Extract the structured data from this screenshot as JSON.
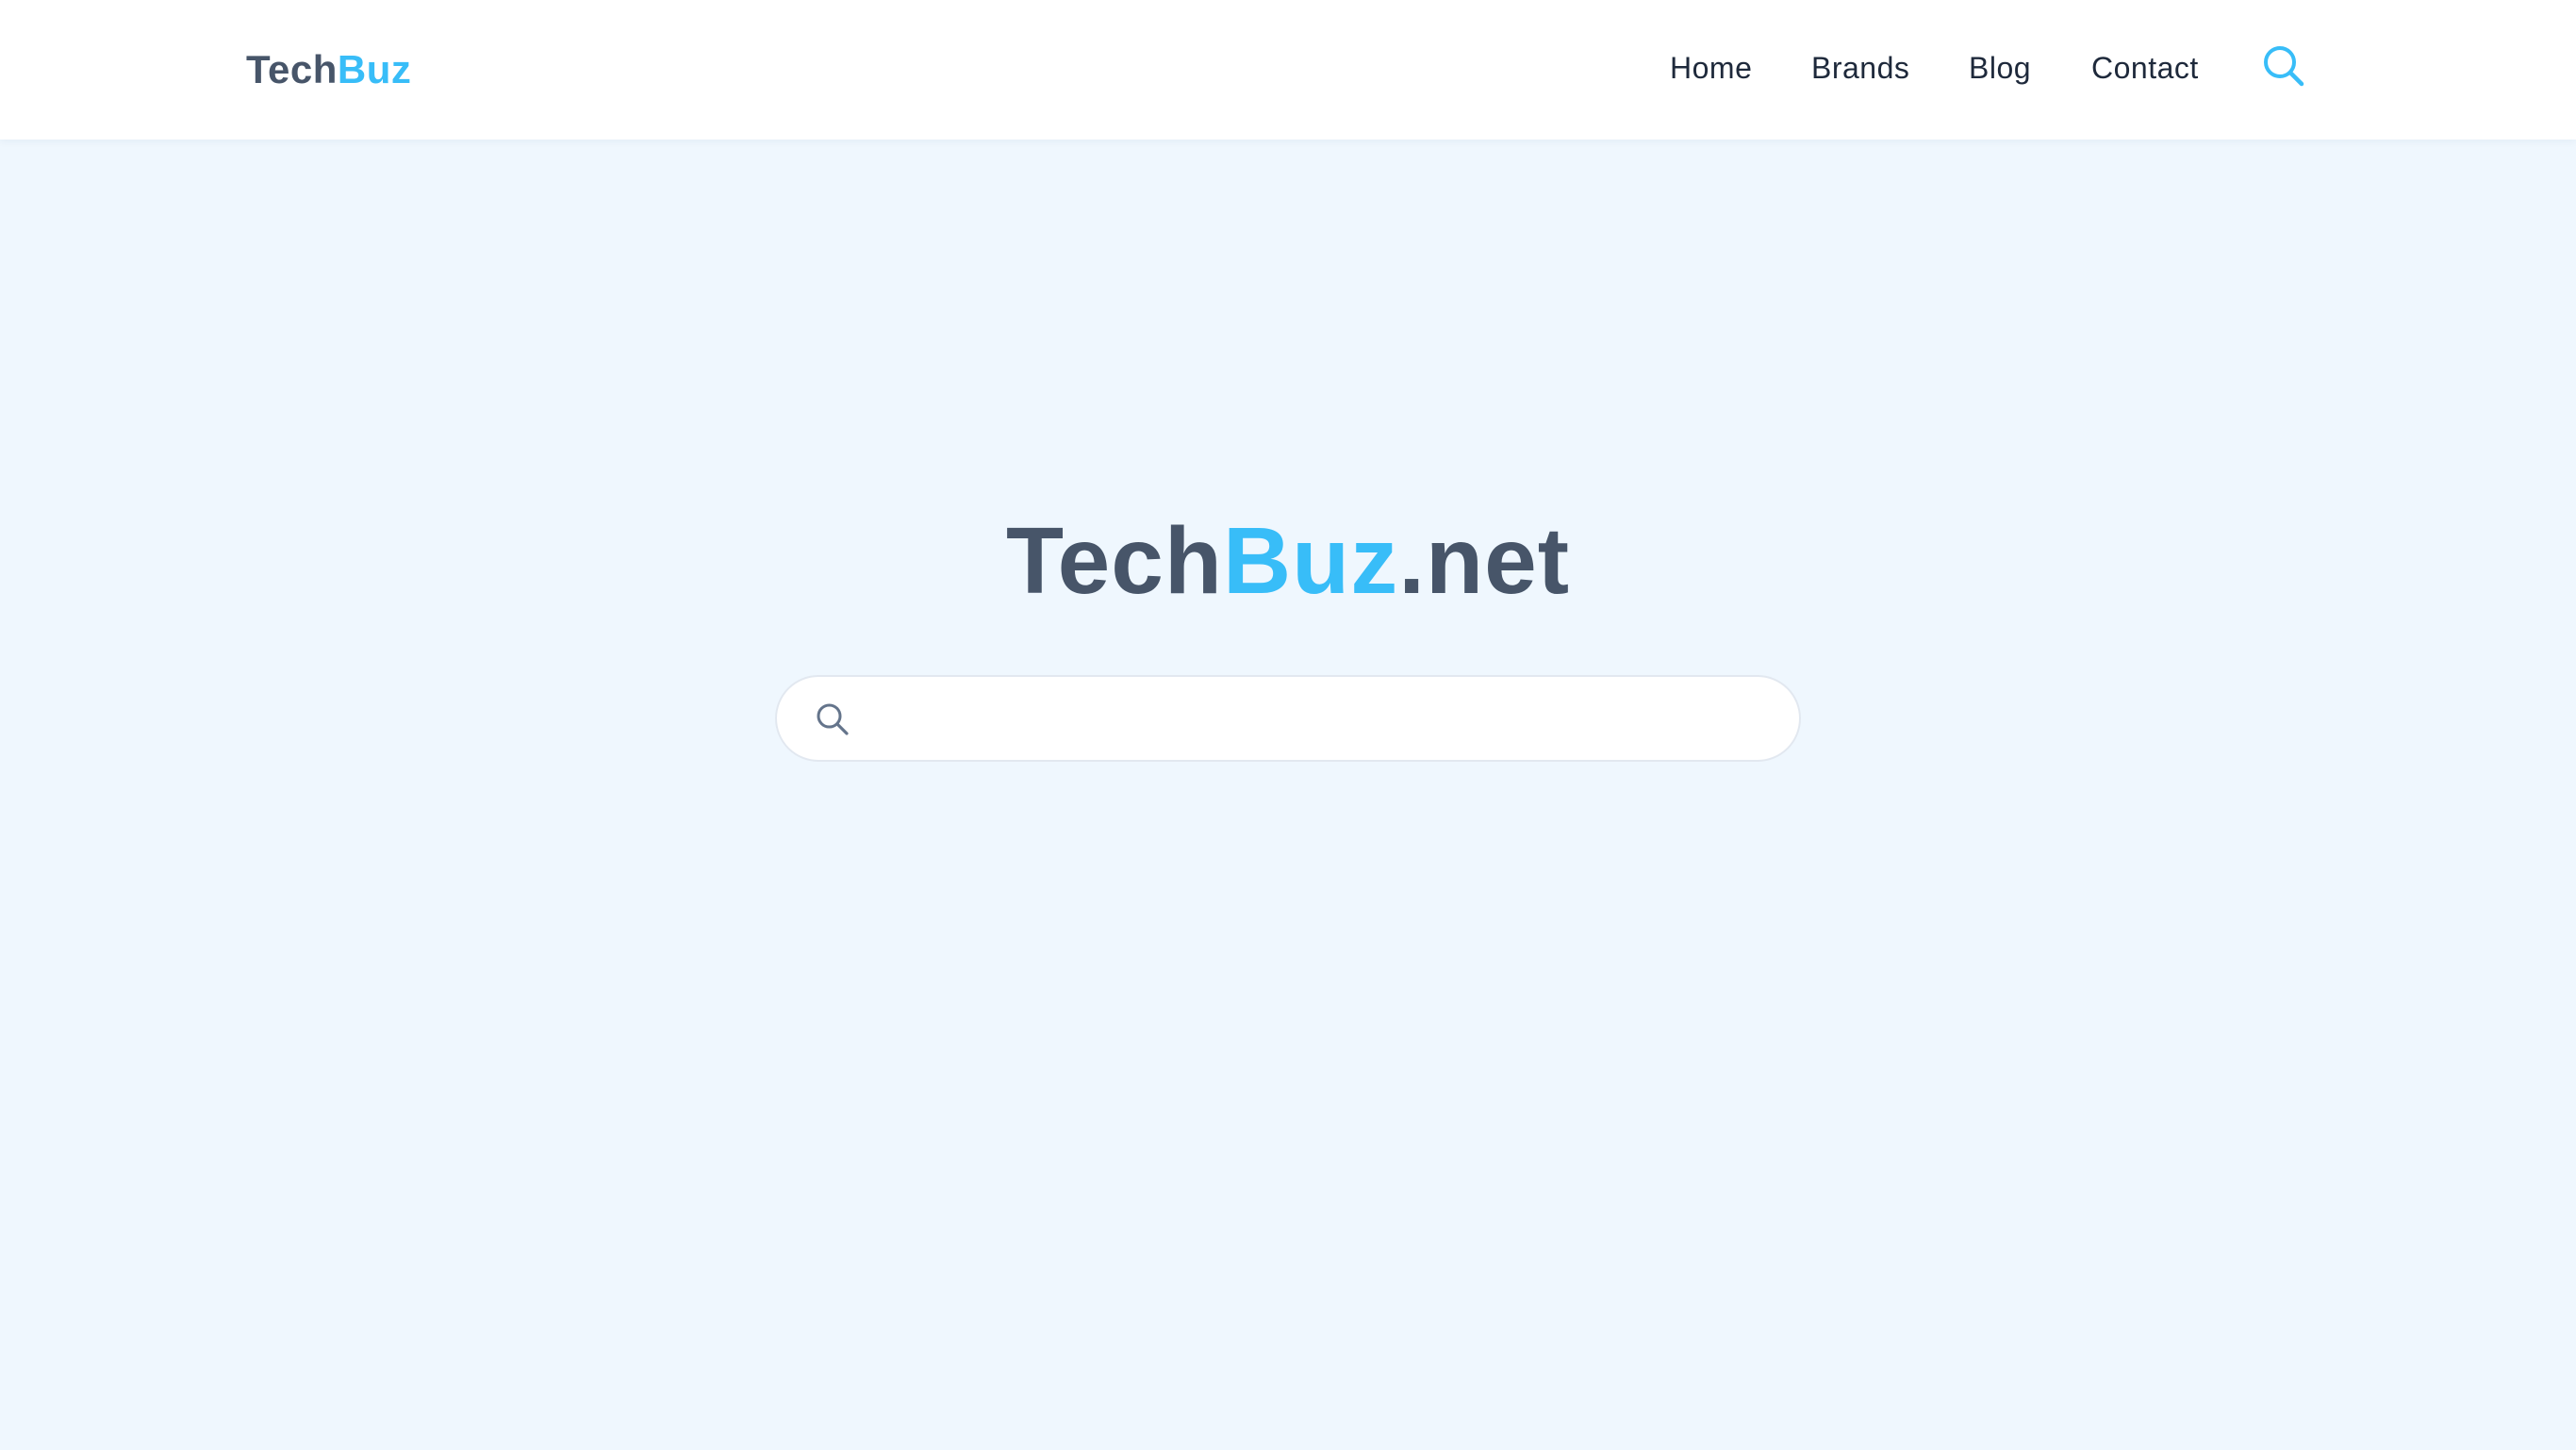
{
  "logo": {
    "part_a": "Tech",
    "part_b": "Buz"
  },
  "nav": {
    "items": [
      {
        "label": "Home"
      },
      {
        "label": "Brands"
      },
      {
        "label": "Blog"
      },
      {
        "label": "Contact"
      }
    ],
    "search_icon": "search-icon"
  },
  "hero": {
    "title_a": "Tech",
    "title_b": "Buz",
    "title_c": ".net"
  },
  "search": {
    "value": "",
    "placeholder": "",
    "icon": "search-icon"
  },
  "colors": {
    "accent": "#38bdf8",
    "text_dark": "#475569",
    "nav_text": "#1e293b",
    "background": "#eff7fe",
    "header_bg": "#ffffff"
  }
}
